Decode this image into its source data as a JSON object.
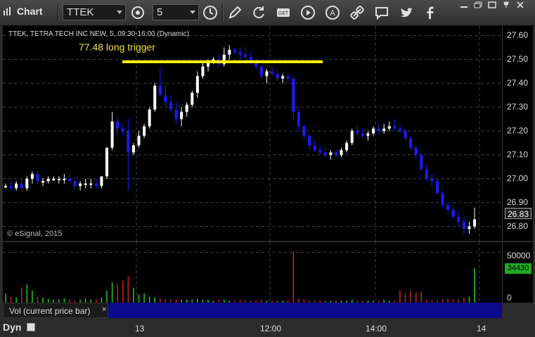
{
  "toolbar": {
    "title": "Chart",
    "symbol": "TTEK",
    "interval": "5",
    "icons": [
      "interval-settings-icon",
      "clock-icon",
      "pencil-icon",
      "refresh-icon",
      "get-icon",
      "play-icon",
      "alert-icon",
      "link-icon",
      "message-icon",
      "twitter-icon",
      "facebook-icon"
    ]
  },
  "chart": {
    "info_line": "TTEK, TETRA TECH INC NEW, 5, 09:30-16:00 (Dynamic)",
    "annotation": "77.48 long trigger",
    "copyright": "© eSignal, 2015",
    "last_price": "26.83",
    "price_ticks": [
      "27.60",
      "27.50",
      "27.40",
      "27.30",
      "27.20",
      "27.10",
      "27.00",
      "26.90",
      "26.80"
    ]
  },
  "volume": {
    "label": "Vol (current price bar)",
    "close": "×",
    "tick_top": "50000",
    "tick_bottom": "0",
    "last_volume": "34430"
  },
  "time_axis": {
    "mode": "Dyn",
    "labels": [
      "13",
      "12:00",
      "14:00",
      "14"
    ]
  },
  "colors": {
    "up": "#ffffff",
    "down": "#1a1aff",
    "trigger": "#ffff00",
    "vol_up": "#22cc22",
    "vol_down": "#cc2222"
  },
  "chart_data": {
    "type": "candlestick",
    "ylim": [
      26.74,
      27.64
    ],
    "trigger_level": 27.49,
    "candles": [
      [
        26.97,
        26.98,
        26.96,
        26.97
      ],
      [
        26.97,
        26.99,
        26.95,
        26.96
      ],
      [
        26.96,
        26.99,
        26.95,
        26.98
      ],
      [
        26.98,
        27.0,
        26.95,
        26.96
      ],
      [
        26.96,
        27.01,
        26.95,
        27.0
      ],
      [
        27.0,
        27.03,
        26.98,
        27.02
      ],
      [
        27.02,
        27.03,
        26.98,
        26.99
      ],
      [
        26.99,
        27.0,
        26.97,
        26.99
      ],
      [
        26.99,
        27.01,
        26.98,
        27.0
      ],
      [
        27.0,
        27.01,
        26.99,
        27.0
      ],
      [
        27.0,
        27.01,
        26.98,
        27.0
      ],
      [
        27.0,
        27.02,
        26.98,
        27.0
      ],
      [
        27.0,
        27.02,
        26.99,
        26.99
      ],
      [
        26.99,
        27.0,
        26.96,
        26.97
      ],
      [
        26.97,
        26.99,
        26.95,
        26.98
      ],
      [
        26.98,
        27.0,
        26.96,
        26.98
      ],
      [
        26.98,
        27.0,
        26.96,
        26.98
      ],
      [
        26.98,
        27.0,
        26.96,
        26.97
      ],
      [
        26.97,
        27.01,
        26.96,
        27.01
      ],
      [
        27.01,
        27.13,
        27.0,
        27.13
      ],
      [
        27.13,
        27.28,
        27.12,
        27.24
      ],
      [
        27.24,
        27.26,
        27.18,
        27.21
      ],
      [
        27.21,
        27.23,
        27.18,
        27.2
      ],
      [
        27.2,
        27.25,
        26.95,
        27.11
      ],
      [
        27.11,
        27.15,
        27.1,
        27.14
      ],
      [
        27.14,
        27.2,
        27.13,
        27.18
      ],
      [
        27.18,
        27.23,
        27.17,
        27.22
      ],
      [
        27.22,
        27.3,
        27.21,
        27.29
      ],
      [
        27.29,
        27.4,
        27.28,
        27.39
      ],
      [
        27.39,
        27.47,
        27.37,
        27.35
      ],
      [
        27.35,
        27.4,
        27.3,
        27.32
      ],
      [
        27.32,
        27.35,
        27.28,
        27.29
      ],
      [
        27.29,
        27.32,
        27.23,
        27.25
      ],
      [
        27.25,
        27.3,
        27.22,
        27.28
      ],
      [
        27.28,
        27.32,
        27.26,
        27.31
      ],
      [
        27.31,
        27.37,
        27.3,
        27.36
      ],
      [
        27.36,
        27.45,
        27.34,
        27.43
      ],
      [
        27.43,
        27.49,
        27.42,
        27.47
      ],
      [
        27.47,
        27.5,
        27.45,
        27.49
      ],
      [
        27.49,
        27.51,
        27.48,
        27.5
      ],
      [
        27.5,
        27.52,
        27.47,
        27.48
      ],
      [
        27.48,
        27.55,
        27.47,
        27.52
      ],
      [
        27.52,
        27.56,
        27.5,
        27.54
      ],
      [
        27.54,
        27.55,
        27.52,
        27.53
      ],
      [
        27.53,
        27.55,
        27.5,
        27.52
      ],
      [
        27.52,
        27.55,
        27.5,
        27.51
      ],
      [
        27.51,
        27.53,
        27.48,
        27.49
      ],
      [
        27.49,
        27.5,
        27.46,
        27.47
      ],
      [
        27.47,
        27.48,
        27.42,
        27.43
      ],
      [
        27.43,
        27.46,
        27.4,
        27.45
      ],
      [
        27.45,
        27.47,
        27.43,
        27.44
      ],
      [
        27.44,
        27.46,
        27.41,
        27.42
      ],
      [
        27.42,
        27.44,
        27.4,
        27.43
      ],
      [
        27.43,
        27.44,
        27.4,
        27.42
      ],
      [
        27.42,
        27.43,
        27.25,
        27.28
      ],
      [
        27.28,
        27.3,
        27.2,
        27.22
      ],
      [
        27.22,
        27.23,
        27.17,
        27.18
      ],
      [
        27.18,
        27.19,
        27.12,
        27.14
      ],
      [
        27.14,
        27.16,
        27.11,
        27.12
      ],
      [
        27.12,
        27.14,
        27.1,
        27.11
      ],
      [
        27.11,
        27.13,
        27.09,
        27.1
      ],
      [
        27.1,
        27.12,
        27.08,
        27.11
      ],
      [
        27.11,
        27.12,
        27.09,
        27.1
      ],
      [
        27.1,
        27.13,
        27.09,
        27.12
      ],
      [
        27.12,
        27.16,
        27.11,
        27.15
      ],
      [
        27.15,
        27.21,
        27.14,
        27.2
      ],
      [
        27.2,
        27.22,
        27.18,
        27.19
      ],
      [
        27.19,
        27.21,
        27.17,
        27.18
      ],
      [
        27.18,
        27.2,
        27.16,
        27.19
      ],
      [
        27.19,
        27.22,
        27.18,
        27.21
      ],
      [
        27.21,
        27.23,
        27.19,
        27.2
      ],
      [
        27.2,
        27.23,
        27.19,
        27.21
      ],
      [
        27.21,
        27.24,
        27.2,
        27.22
      ],
      [
        27.22,
        27.25,
        27.2,
        27.21
      ],
      [
        27.21,
        27.23,
        27.19,
        27.2
      ],
      [
        27.2,
        27.21,
        27.16,
        27.17
      ],
      [
        27.17,
        27.18,
        27.12,
        27.13
      ],
      [
        27.13,
        27.14,
        27.08,
        27.1
      ],
      [
        27.1,
        27.11,
        27.03,
        27.04
      ],
      [
        27.04,
        27.06,
        26.99,
        27.0
      ],
      [
        27.0,
        27.02,
        26.97,
        26.99
      ],
      [
        26.99,
        27.0,
        26.93,
        26.94
      ],
      [
        26.94,
        26.95,
        26.88,
        26.89
      ],
      [
        26.89,
        26.9,
        26.85,
        26.87
      ],
      [
        26.87,
        26.89,
        26.83,
        26.84
      ],
      [
        26.84,
        26.86,
        26.8,
        26.82
      ],
      [
        26.82,
        26.84,
        26.77,
        26.79
      ],
      [
        26.79,
        26.82,
        26.77,
        26.8
      ],
      [
        26.8,
        26.88,
        26.79,
        26.83
      ]
    ],
    "volume": [
      9000,
      6000,
      5000,
      15000,
      18000,
      12000,
      6000,
      5000,
      4000,
      3000,
      3000,
      4000,
      3000,
      2000,
      3000,
      4000,
      3000,
      3000,
      5000,
      12000,
      20000,
      18000,
      22000,
      26000,
      15000,
      8000,
      9000,
      6000,
      5000,
      4000,
      3000,
      3000,
      3000,
      3000,
      3000,
      3000,
      4000,
      3000,
      3000,
      2000,
      3000,
      3000,
      2000,
      2000,
      3000,
      2000,
      2000,
      2000,
      3000,
      2000,
      2000,
      2000,
      2000,
      2000,
      51000,
      4000,
      3000,
      2000,
      2000,
      2000,
      2000,
      2000,
      2000,
      2000,
      2000,
      3000,
      2000,
      2000,
      2000,
      2000,
      2000,
      3000,
      2000,
      2000,
      12000,
      9000,
      12000,
      10000,
      11000,
      3000,
      2000,
      2000,
      3000,
      4000,
      3000,
      3000,
      5000,
      6000,
      34430
    ],
    "volume_ylim": [
      0,
      60000
    ]
  }
}
